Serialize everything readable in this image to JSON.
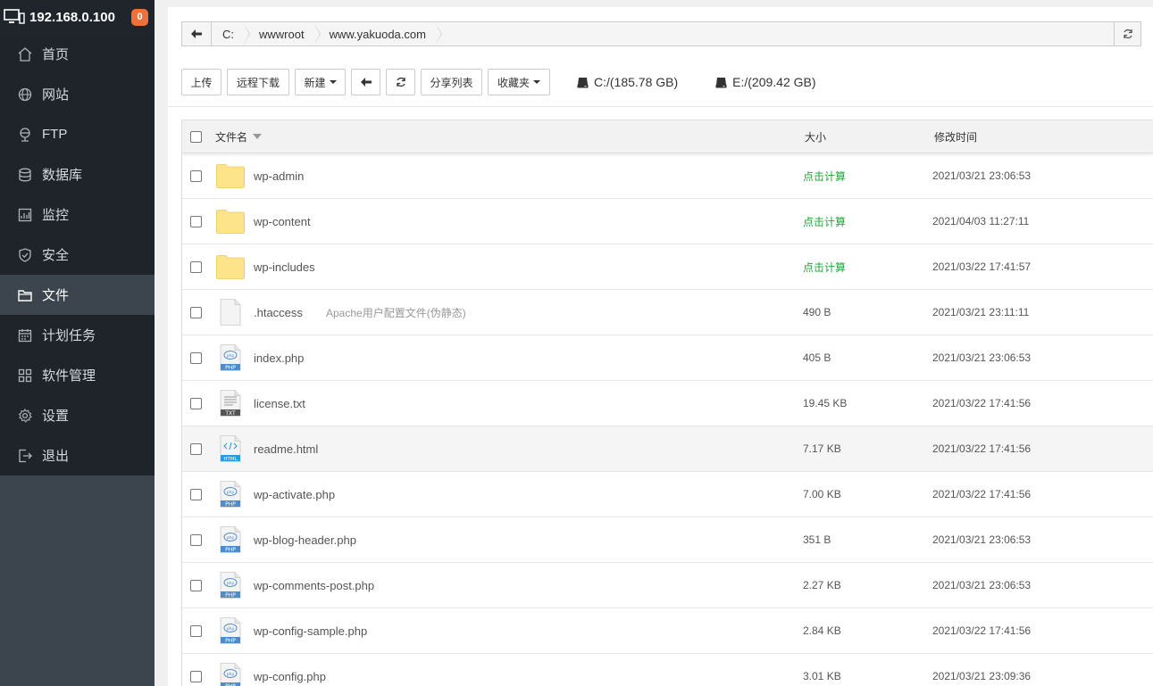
{
  "server": {
    "ip": "192.168.0.100",
    "notifications": "0"
  },
  "menu": [
    {
      "label": "首页",
      "icon": "home-icon"
    },
    {
      "label": "网站",
      "icon": "globe-icon"
    },
    {
      "label": "FTP",
      "icon": "ftp-icon"
    },
    {
      "label": "数据库",
      "icon": "database-icon"
    },
    {
      "label": "监控",
      "icon": "monitor-chart-icon"
    },
    {
      "label": "安全",
      "icon": "shield-icon"
    },
    {
      "label": "文件",
      "icon": "folder-icon",
      "active": true
    },
    {
      "label": "计划任务",
      "icon": "calendar-icon"
    },
    {
      "label": "软件管理",
      "icon": "apps-grid-icon"
    },
    {
      "label": "设置",
      "icon": "gear-icon"
    },
    {
      "label": "退出",
      "icon": "logout-icon"
    }
  ],
  "path": {
    "crumbs": [
      "C:",
      "wwwroot",
      "www.yakuoda.com"
    ]
  },
  "toolbar": {
    "upload": "上传",
    "remote_download": "远程下载",
    "new": "新建",
    "share_list": "分享列表",
    "favorites": "收藏夹"
  },
  "disks": [
    {
      "label": "C:/(185.78 GB)"
    },
    {
      "label": "E:/(209.42 GB)"
    }
  ],
  "table": {
    "headers": {
      "name": "文件名",
      "size": "大小",
      "mtime": "修改时间"
    },
    "rows": [
      {
        "name": "wp-admin",
        "type": "folder",
        "size": "点击计算",
        "mtime": "2021/03/21 23:06:53"
      },
      {
        "name": "wp-content",
        "type": "folder",
        "size": "点击计算",
        "mtime": "2021/04/03 11:27:11"
      },
      {
        "name": "wp-includes",
        "type": "folder",
        "size": "点击计算",
        "mtime": "2021/03/22 17:41:57"
      },
      {
        "name": ".htaccess",
        "type": "blank",
        "desc": "Apache用户配置文件(伪静态)",
        "size": "490 B",
        "mtime": "2021/03/21 23:11:11"
      },
      {
        "name": "index.php",
        "type": "php",
        "size": "405 B",
        "mtime": "2021/03/21 23:06:53"
      },
      {
        "name": "license.txt",
        "type": "txt",
        "size": "19.45 KB",
        "mtime": "2021/03/22 17:41:56"
      },
      {
        "name": "readme.html",
        "type": "html",
        "size": "7.17 KB",
        "mtime": "2021/03/22 17:41:56"
      },
      {
        "name": "wp-activate.php",
        "type": "php",
        "size": "7.00 KB",
        "mtime": "2021/03/22 17:41:56"
      },
      {
        "name": "wp-blog-header.php",
        "type": "php",
        "size": "351 B",
        "mtime": "2021/03/21 23:06:53"
      },
      {
        "name": "wp-comments-post.php",
        "type": "php",
        "size": "2.27 KB",
        "mtime": "2021/03/21 23:06:53"
      },
      {
        "name": "wp-config-sample.php",
        "type": "php",
        "size": "2.84 KB",
        "mtime": "2021/03/22 17:41:56"
      },
      {
        "name": "wp-config.php",
        "type": "php",
        "size": "3.01 KB",
        "mtime": "2021/03/21 23:09:36"
      }
    ]
  },
  "colors": {
    "sidebar": "#3c444d",
    "sidebar_dark": "#1e242a",
    "badge": "#f0703a",
    "calc_green": "#20a53a",
    "folder": "#fde48a"
  }
}
